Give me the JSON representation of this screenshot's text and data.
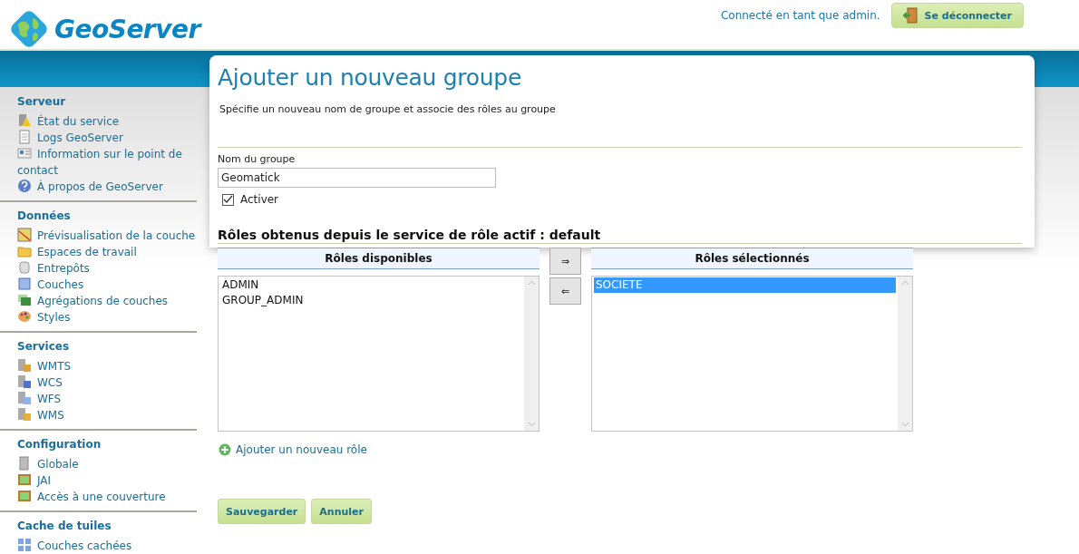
{
  "header": {
    "logo_text": "GeoServer",
    "login_status": "Connecté en tant que admin.",
    "logout_button": "Se déconnecter"
  },
  "sidebar": {
    "sections": [
      {
        "title": "Serveur",
        "items": [
          "État du service",
          "Logs GeoServer",
          "Information sur le point de contact",
          "À propos de GeoServer"
        ]
      },
      {
        "title": "Données",
        "items": [
          "Prévisualisation de la couche",
          "Espaces de travail",
          "Entrepôts",
          "Couches",
          "Agrégations de couches",
          "Styles"
        ]
      },
      {
        "title": "Services",
        "items": [
          "WMTS",
          "WCS",
          "WFS",
          "WMS"
        ]
      },
      {
        "title": "Configuration",
        "items": [
          "Globale",
          "JAI",
          "Accès à une couverture"
        ]
      },
      {
        "title": "Cache de tuiles",
        "items": [
          "Couches cachées"
        ]
      }
    ]
  },
  "page": {
    "title": "Ajouter un nouveau groupe",
    "description": "Spécifie un nouveau nom de groupe et associe des rôles au groupe",
    "group_name": {
      "label": "Nom du groupe",
      "value": "Geomatick"
    },
    "enabled": {
      "label": "Activer",
      "checked": true
    },
    "roles_heading": "Rôles obtenus depuis le service de rôle actif : default",
    "available": {
      "header": "Rôles disponibles",
      "items": [
        {
          "label": "ADMIN",
          "selected": false
        },
        {
          "label": "GROUP_ADMIN",
          "selected": false
        }
      ]
    },
    "move_buttons": [
      "⇒",
      "⇐"
    ],
    "chosen": {
      "header": "Rôles sélectionnés",
      "items": [
        {
          "label": "SOCIETE",
          "selected": true
        }
      ]
    },
    "add_role_link": "Ajouter un nouveau rôle",
    "buttons": [
      "Sauvegarder",
      "Annuler"
    ]
  }
}
